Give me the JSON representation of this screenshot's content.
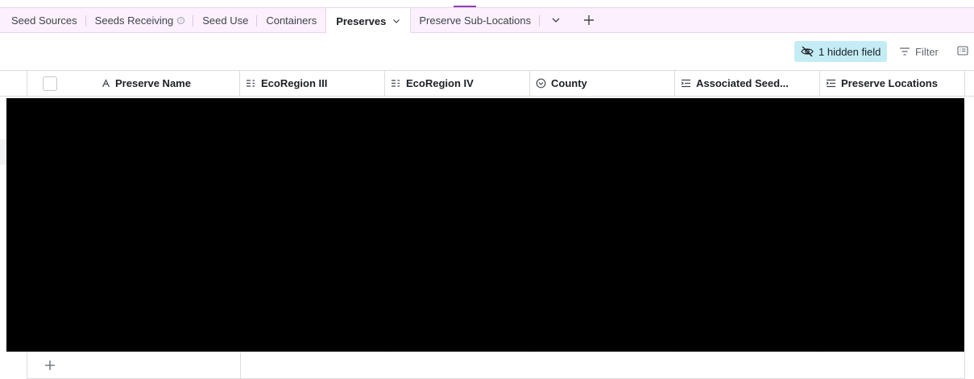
{
  "tabs": [
    {
      "label": "Seed Sources"
    },
    {
      "label": "Seeds Receiving"
    },
    {
      "label": "Seed Use"
    },
    {
      "label": "Containers"
    },
    {
      "label": "Preserves"
    },
    {
      "label": "Preserve Sub-Locations"
    }
  ],
  "toolbar": {
    "hidden_fields_label": "1 hidden field",
    "filter_label": "Filter"
  },
  "columns": [
    {
      "label": "Preserve Name",
      "icon": "text-field-icon"
    },
    {
      "label": "EcoRegion III",
      "icon": "multiselect-field-icon"
    },
    {
      "label": "EcoRegion IV",
      "icon": "multiselect-field-icon"
    },
    {
      "label": "County",
      "icon": "single-select-field-icon"
    },
    {
      "label": "Associated Seed...",
      "icon": "linked-record-field-icon"
    },
    {
      "label": "Preserve Locations",
      "icon": "linked-record-field-icon"
    }
  ],
  "colors": {
    "accent": "#8f3fb0",
    "tabbar_bg": "#fbf0fc",
    "hidden_btn_bg": "#c4ecf5"
  }
}
